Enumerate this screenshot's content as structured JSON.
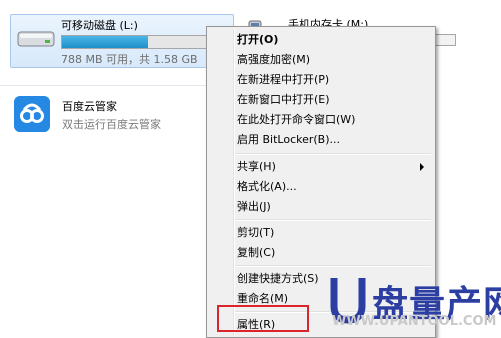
{
  "drives": [
    {
      "name": "可移动磁盘 (L:)",
      "size_text": "788 MB 可用，共 1.58 GB",
      "used_fraction": 0.52,
      "icon": "removable-drive-icon"
    },
    {
      "name": "手机内存卡 (M:)",
      "icon": "phone-drive-icon"
    }
  ],
  "program": {
    "name": "百度云管家",
    "description": "双击运行百度云管家",
    "icon": "baidu-cloud-icon"
  },
  "context_menu": {
    "items": [
      {
        "label": "打开(O)",
        "bold": true
      },
      {
        "label": "高强度加密(M)"
      },
      {
        "label": "在新进程中打开(P)"
      },
      {
        "label": "在新窗口中打开(E)"
      },
      {
        "label": "在此处打开命令窗口(W)"
      },
      {
        "label": "启用 BitLocker(B)..."
      },
      {
        "label": "共享(H)",
        "submenu": true
      },
      {
        "label": "格式化(A)..."
      },
      {
        "label": "弹出(J)"
      },
      {
        "label": "剪切(T)"
      },
      {
        "label": "复制(C)"
      },
      {
        "label": "创建快捷方式(S)"
      },
      {
        "label": "重命名(M)"
      },
      {
        "label": "属性(R)",
        "highlighted_box": true
      }
    ]
  },
  "watermark": {
    "brand": "盘量产网",
    "url": "WWW.UPANTOOL.COM"
  },
  "colors": {
    "highlight_box": "#d9252b",
    "drive_bar": "#1e8fc9",
    "brand_blue": "#2d3ea3"
  }
}
